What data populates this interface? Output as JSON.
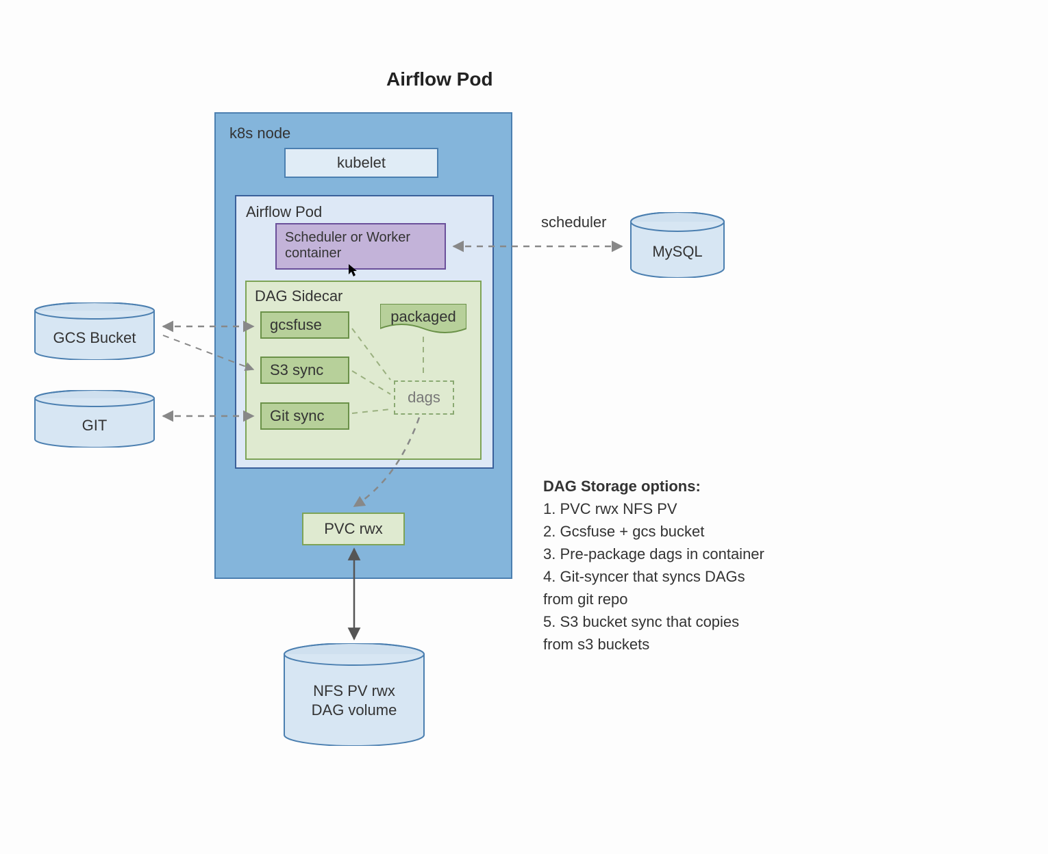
{
  "title": "Airflow Pod",
  "node_label": "k8s node",
  "kubelet": "kubelet",
  "pod_label": "Airflow Pod",
  "scheduler_worker": "Scheduler or Worker container",
  "sidecar_label": "DAG Sidecar",
  "gcsfuse": "gcsfuse",
  "s3sync": "S3 sync",
  "gitsync": "Git sync",
  "packaged": "packaged",
  "dags": "dags",
  "pvc": "PVC rwx",
  "scheduler_edge": "scheduler",
  "mysql": "MySQL",
  "gcs_bucket": "GCS Bucket",
  "git": "GIT",
  "nfs": "NFS PV rwx\nDAG volume",
  "options": {
    "heading": "DAG Storage options:",
    "items": [
      "1. PVC rwx NFS PV",
      "2. Gcsfuse + gcs bucket",
      "3. Pre-package dags in container",
      "4. Git-syncer that syncs DAGs from git repo",
      "5. S3 bucket sync that copies from s3 buckets"
    ]
  }
}
